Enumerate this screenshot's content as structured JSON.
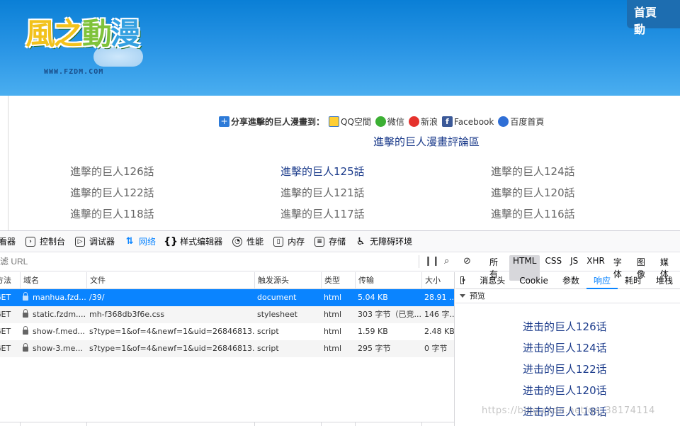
{
  "site": {
    "logo_title_a": "風之",
    "logo_title_b": "動",
    "logo_title_c": "漫",
    "logo_url": "WWW.FZDM.COM",
    "nav": [
      "首頁",
      "動"
    ]
  },
  "share": {
    "lead": "分享進擊的巨人漫畫到：",
    "targets": [
      "QQ空間",
      "微信",
      "新浪",
      "Facebook",
      "百度首頁"
    ]
  },
  "comment_link": "進擊的巨人漫畫評論區",
  "chapters": [
    {
      "label": "進擊的巨人126話",
      "highlight": false
    },
    {
      "label": "進擊的巨人125話",
      "highlight": true
    },
    {
      "label": "進擊的巨人124話",
      "highlight": false
    },
    {
      "label": "進擊的巨人122話",
      "highlight": false
    },
    {
      "label": "進擊的巨人121話",
      "highlight": false
    },
    {
      "label": "進擊的巨人120話",
      "highlight": false
    },
    {
      "label": "進擊的巨人118話",
      "highlight": false
    },
    {
      "label": "進擊的巨人117話",
      "highlight": false
    },
    {
      "label": "進擊的巨人116話",
      "highlight": false
    }
  ],
  "devtools": {
    "tabs": [
      "查看器",
      "控制台",
      "调试器",
      "网络",
      "样式编辑器",
      "性能",
      "内存",
      "存储",
      "无障碍环境"
    ],
    "active_tab": "网络",
    "filter_placeholder": "过滤 URL",
    "type_filters": [
      "所有",
      "HTML",
      "CSS",
      "JS",
      "XHR",
      "字体",
      "图像",
      "媒体"
    ],
    "active_type_filter": "HTML",
    "columns": [
      "方法",
      "域名",
      "文件",
      "触发源头",
      "类型",
      "传输",
      "大小"
    ],
    "requests": [
      {
        "method": "GET",
        "domain": "manhua.fzd...",
        "file": "/39/",
        "cause": "document",
        "type": "html",
        "transferred": "5.04 KB",
        "size": "28.91 ..."
      },
      {
        "method": "GET",
        "domain": "static.fzdm....",
        "file": "mh-f368db3f6e.css",
        "cause": "stylesheet",
        "type": "html",
        "transferred": "303 字节（已竞...",
        "size": "146 字..."
      },
      {
        "method": "GET",
        "domain": "show-f.med...",
        "file": "s?type=1&of=4&newf=1&uid=26846813...",
        "cause": "script",
        "type": "html",
        "transferred": "1.59 KB",
        "size": "2.48 KB"
      },
      {
        "method": "GET",
        "domain": "show-3.me...",
        "file": "s?type=1&of=4&newf=1&uid=26846813...",
        "cause": "script",
        "type": "html",
        "transferred": "295 字节",
        "size": "0 字节"
      }
    ],
    "detail_tabs": [
      "消息头",
      "Cookie",
      "参数",
      "响应",
      "耗时",
      "堆栈"
    ],
    "active_detail_tab": "响应",
    "preview_label": "预览",
    "preview_links": [
      "进击的巨人126话",
      "进击的巨人124话",
      "进击的巨人122话",
      "进击的巨人120话",
      "进击的巨人118话"
    ]
  },
  "watermark": "https://blog.csdn.net/qq_38174114"
}
